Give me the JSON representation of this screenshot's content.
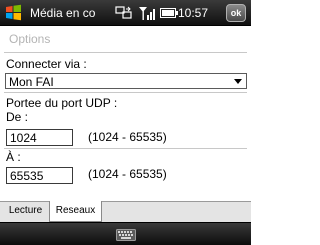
{
  "statusbar": {
    "app_title": "Média en co",
    "time": "10:57",
    "ok_label": "ok",
    "icons": [
      "windows-start-icon",
      "connection-icon",
      "signal-icon",
      "battery-icon"
    ]
  },
  "header": {
    "title": "Options"
  },
  "form": {
    "connect_label": "Connecter via :",
    "connect_value": "Mon FAI",
    "udp_label": "Portee du port UDP :",
    "from_label": "De :",
    "from_value": "1024",
    "from_range": "(1024 - 65535)",
    "to_label": "À :",
    "to_value": "65535",
    "to_range": "(1024 - 65535)"
  },
  "tabs": [
    {
      "label": "Lecture",
      "selected": false
    },
    {
      "label": "Reseaux",
      "selected": true
    }
  ],
  "bottombar": {
    "icon": "keyboard-icon"
  },
  "colors": {
    "bar_dark": "#1a1a1a",
    "title_grey": "#b4b4b4",
    "tab_bg": "#e4e4e4"
  }
}
